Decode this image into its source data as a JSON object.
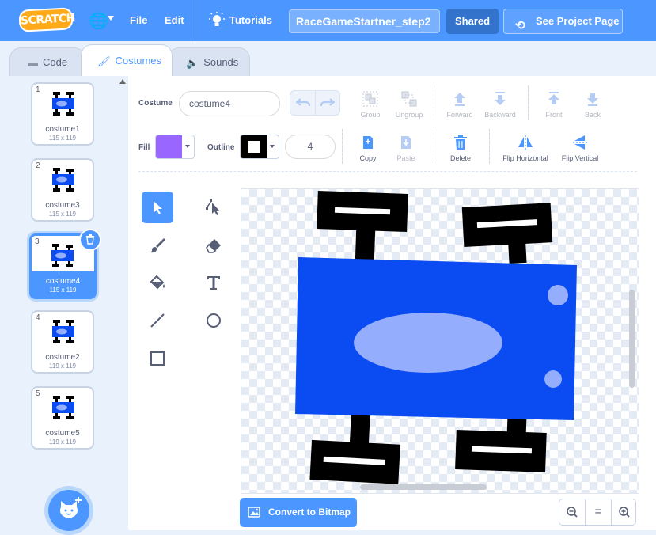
{
  "menubar": {
    "logo_text": "SCRATCH",
    "file_label": "File",
    "edit_label": "Edit",
    "tutorials_label": "Tutorials",
    "project_title": "RaceGameStartner_step2",
    "shared_label": "Shared",
    "see_project_label": "See Project Page"
  },
  "tabs": {
    "code_label": "Code",
    "costumes_label": "Costumes",
    "sounds_label": "Sounds"
  },
  "costumes": [
    {
      "num": "1",
      "name": "costume1",
      "size": "115 x 119"
    },
    {
      "num": "2",
      "name": "costume3",
      "size": "115 x 119"
    },
    {
      "num": "3",
      "name": "costume4",
      "size": "115 x 119"
    },
    {
      "num": "4",
      "name": "costume2",
      "size": "119 x 119"
    },
    {
      "num": "5",
      "name": "costume5",
      "size": "119 x 119"
    }
  ],
  "editor": {
    "costume_label": "Costume",
    "costume_name": "costume4",
    "fill_label": "Fill",
    "outline_label": "Outline",
    "outline_width": "4",
    "fill_color": "#9966ff",
    "outline_color": "#000000",
    "toolbar": {
      "group": "Group",
      "ungroup": "Ungroup",
      "forward": "Forward",
      "backward": "Backward",
      "front": "Front",
      "back": "Back",
      "copy": "Copy",
      "paste": "Paste",
      "delete": "Delete",
      "flip_horizontal": "Flip Horizontal",
      "flip_vertical": "Flip Vertical"
    },
    "convert_label": "Convert to Bitmap",
    "zoom_reset": "="
  },
  "colors": {
    "brand": "#4c97ff",
    "car_body": "#0b4bf2",
    "car_window": "#94adfc"
  }
}
